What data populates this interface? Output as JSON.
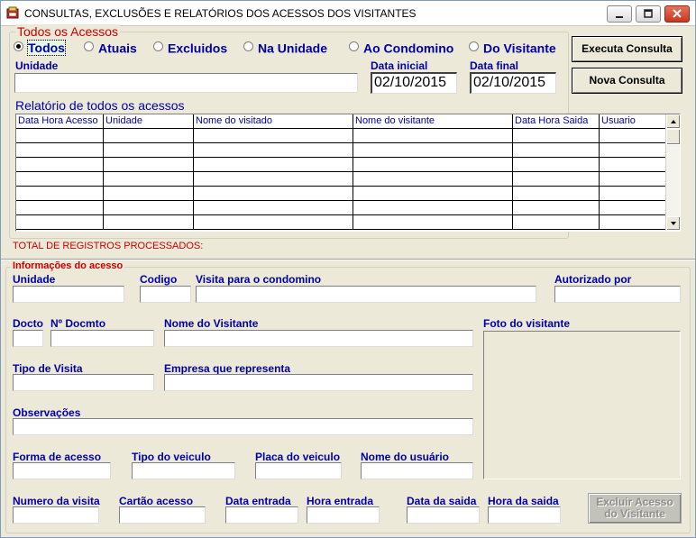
{
  "window": {
    "title": "CONSULTAS, EXCLUSÕES E RELATÓRIOS DOS ACESSOS DOS VISITANTES"
  },
  "filter": {
    "group_title": "Todos os Acessos",
    "options": [
      "Todos",
      "Atuais",
      "Excluidos",
      "Na Unidade",
      "Ao Condomino",
      "Do Visitante"
    ],
    "selected": "Todos",
    "unidade_label": "Unidade",
    "unidade_value": "",
    "data_inicial_label": "Data inicial",
    "data_inicial_value": "02/10/2015",
    "data_final_label": "Data final",
    "data_final_value": "02/10/2015"
  },
  "buttons": {
    "executa": "Executa Consulta",
    "nova": "Nova Consulta",
    "excluir_line1": "Excluir Acesso",
    "excluir_line2": "do Visitante"
  },
  "report": {
    "title": "Relatório de todos os acessos",
    "columns": [
      "Data Hora Acesso",
      "Unidade",
      "Nome do visitado",
      "Nome do visitante",
      "Data Hora Saida",
      "Usuario"
    ],
    "rows": [
      [
        "",
        "",
        "",
        "",
        "",
        ""
      ],
      [
        "",
        "",
        "",
        "",
        "",
        ""
      ],
      [
        "",
        "",
        "",
        "",
        "",
        ""
      ],
      [
        "",
        "",
        "",
        "",
        "",
        ""
      ],
      [
        "",
        "",
        "",
        "",
        "",
        ""
      ],
      [
        "",
        "",
        "",
        "",
        "",
        ""
      ],
      [
        "",
        "",
        "",
        "",
        "",
        ""
      ]
    ],
    "total_label": "TOTAL DE REGISTROS PROCESSADOS:"
  },
  "info": {
    "group_title": "Informações do acesso",
    "unidade": "Unidade",
    "codigo": "Codigo",
    "visita_para": "Visita para o condomino",
    "autorizado_por": "Autorizado por",
    "docto": "Docto",
    "num_docmto": "Nº Docmto",
    "nome_visitante": "Nome do Visitante",
    "foto": "Foto do visitante",
    "tipo_visita": "Tipo de Visita",
    "empresa": "Empresa que representa",
    "observacoes": "Observações",
    "forma_acesso": "Forma de acesso",
    "tipo_veiculo": "Tipo do veiculo",
    "placa_veiculo": "Placa do veiculo",
    "nome_usuario": "Nome do usuário",
    "numero_visita": "Numero da visita",
    "cartao_acesso": "Cartão acesso",
    "data_entrada": "Data entrada",
    "hora_entrada": "Hora entrada",
    "data_saida": "Data da saida",
    "hora_saida": "Hora da saida"
  }
}
